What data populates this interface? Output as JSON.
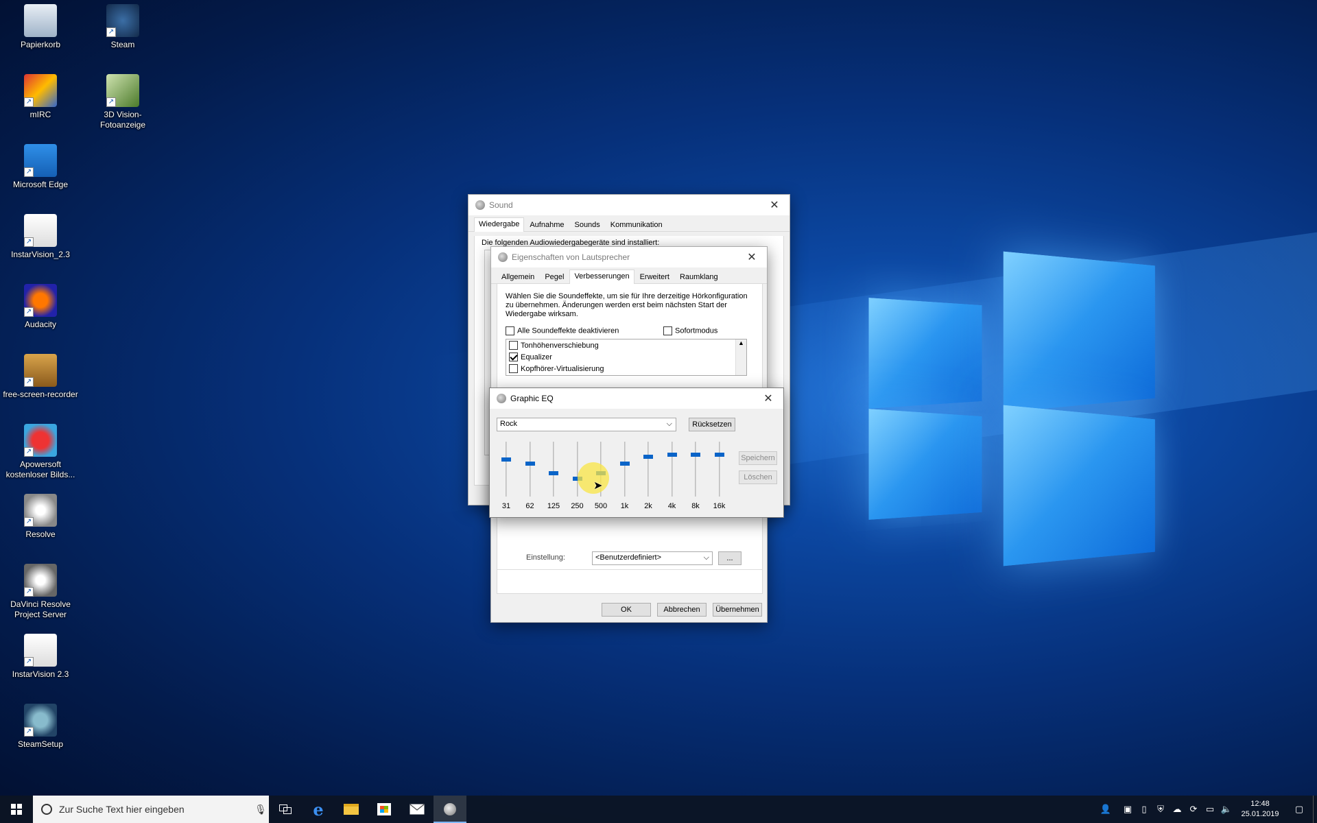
{
  "desktop": {
    "icons": [
      {
        "label": "Papierkorb",
        "icon": "recycle-bin-icon"
      },
      {
        "label": "Steam",
        "icon": "steam-icon"
      },
      {
        "label": "mIRC",
        "icon": "mirc-icon"
      },
      {
        "label": "3D Vision-Fotoanzeige",
        "icon": "3d-vision-icon"
      },
      {
        "label": "Microsoft Edge",
        "icon": "edge-icon"
      },
      {
        "label": "InstarVision_2.3",
        "icon": "instarvision-icon"
      },
      {
        "label": "Audacity",
        "icon": "audacity-icon"
      },
      {
        "label": "free-screen-recorder",
        "icon": "free-screen-recorder-icon"
      },
      {
        "label": "Apowersoft kostenloser Bilds...",
        "icon": "apowersoft-icon"
      },
      {
        "label": "Resolve",
        "icon": "resolve-icon"
      },
      {
        "label": "DaVinci Resolve Project Server",
        "icon": "davinci-project-server-icon"
      },
      {
        "label": "InstarVision 2.3",
        "icon": "instarvision-icon"
      },
      {
        "label": "SteamSetup",
        "icon": "steamsetup-icon"
      }
    ]
  },
  "sound_window": {
    "title": "Sound",
    "tabs": [
      "Wiedergabe",
      "Aufnahme",
      "Sounds",
      "Kommunikation"
    ],
    "active_tab": "Wiedergabe",
    "partial_text": "Die folgenden Audiowiedergabegeräte sind installiert:"
  },
  "properties_window": {
    "title": "Eigenschaften von Lautsprecher",
    "tabs": [
      "Allgemein",
      "Pegel",
      "Verbesserungen",
      "Erweitert",
      "Raumklang"
    ],
    "active_tab": "Verbesserungen",
    "description": "Wählen Sie die Soundeffekte, um sie für Ihre derzeitige Hörkonfiguration zu übernehmen. Änderungen werden erst beim nächsten Start der Wiedergabe wirksam.",
    "disable_all_label": "Alle Soundeffekte deaktivieren",
    "disable_all_checked": false,
    "immediate_mode_label": "Sofortmodus",
    "immediate_mode_checked": false,
    "effects": [
      {
        "label": "Tonhöhenverschiebung",
        "checked": false
      },
      {
        "label": "Equalizer",
        "checked": true
      },
      {
        "label": "Kopfhörer-Virtualisierung",
        "checked": false
      }
    ],
    "setting_label": "Einstellung:",
    "setting_value": "<Benutzerdefiniert>",
    "ellipsis_button": "...",
    "ok_button": "OK",
    "cancel_button": "Abbrechen",
    "apply_button": "Übernehmen"
  },
  "graphic_eq": {
    "title": "Graphic EQ",
    "preset": "Rock",
    "reset_button": "Rücksetzen",
    "save_button": "Speichern",
    "delete_button": "Löschen",
    "bands": [
      {
        "label": "31",
        "level": 0.68
      },
      {
        "label": "62",
        "level": 0.6
      },
      {
        "label": "125",
        "level": 0.42
      },
      {
        "label": "250",
        "level": 0.32
      },
      {
        "label": "500",
        "level": 0.42
      },
      {
        "label": "1k",
        "level": 0.6
      },
      {
        "label": "2k",
        "level": 0.72
      },
      {
        "label": "4k",
        "level": 0.76
      },
      {
        "label": "8k",
        "level": 0.76
      },
      {
        "label": "16k",
        "level": 0.76
      }
    ]
  },
  "taskbar": {
    "search_placeholder": "Zur Suche Text hier eingeben",
    "time": "12:48",
    "date": "25.01.2019"
  }
}
